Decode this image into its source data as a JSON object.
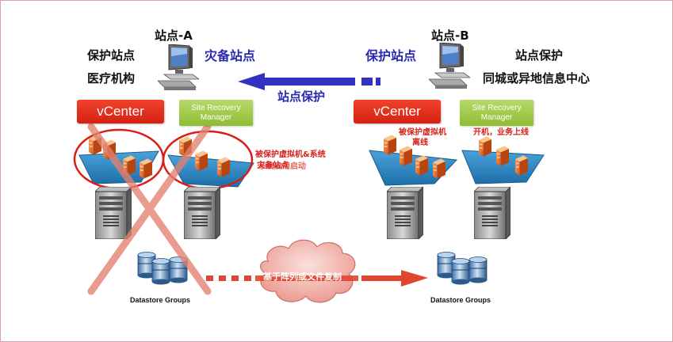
{
  "site_a": {
    "name": "站点-A",
    "role": "保护站点",
    "org": "医疗机构",
    "vcenter_label": "vCenter",
    "srm_line1": "Site Recovery",
    "srm_line2": "Manager",
    "datastore_label": "Datastore Groups"
  },
  "site_b": {
    "name": "站点-B",
    "role": "站点保护",
    "org": "同城或异地信息中心",
    "vcenter_label": "vCenter",
    "srm_line1": "Site Recovery",
    "srm_line2": "Manager",
    "datastore_label": "Datastore Groups",
    "vm_offline_line1": "被保护虚拟机",
    "vm_offline_line2": "离线",
    "power_on": "开机，业务上线"
  },
  "arrow": {
    "left_label": "灾备站点",
    "right_label": "保护站点",
    "under_label": "站点保护"
  },
  "overlap_note": {
    "line1": "被保护虚拟机&系统",
    "line2_a": "灾备站点",
    "line2_b": "系统启用启动"
  },
  "replication": {
    "label": "基于阵列或文件复制"
  },
  "colors": {
    "red": "#d91e18",
    "blue": "#2828b4",
    "vcenter": "#e5311e",
    "srm": "#9dc845"
  }
}
